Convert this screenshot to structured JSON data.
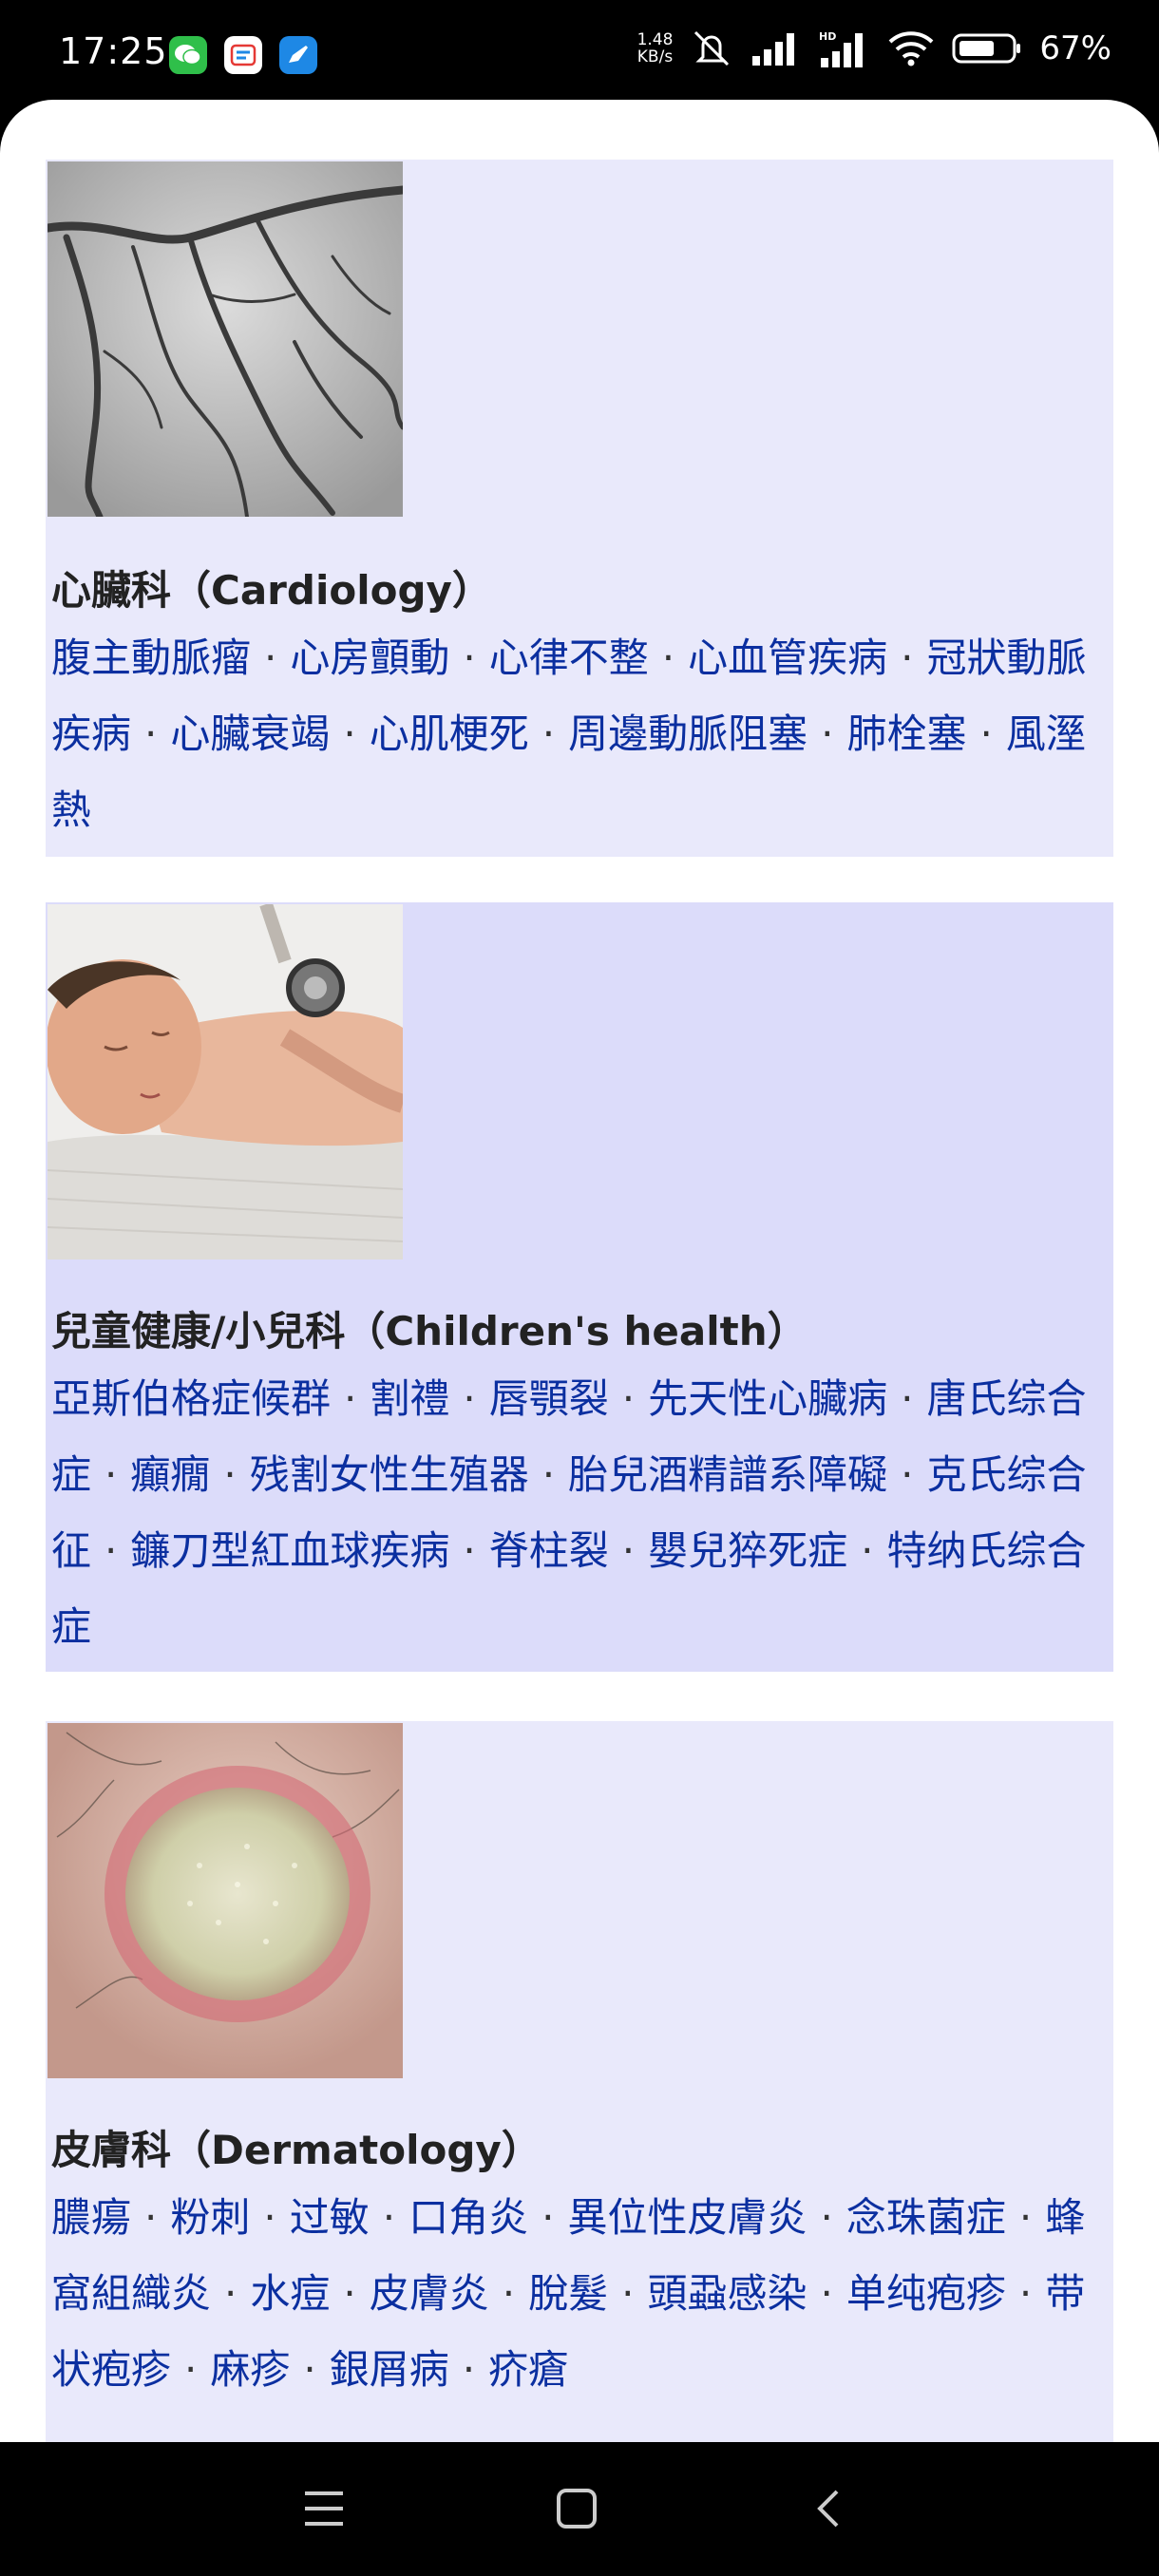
{
  "status_bar": {
    "time": "17:25",
    "speed_value": "1.48",
    "speed_unit": "KB/s",
    "battery_pct": "67%",
    "apps": [
      "wechat-icon",
      "cloud-app-icon",
      "messenger-app-icon"
    ],
    "icons": [
      "mute-icon",
      "signal-icon",
      "hd-signal-icon",
      "wifi-icon",
      "battery-icon"
    ]
  },
  "sections": [
    {
      "title": "心臟科（Cardiology）",
      "image": "coronary-angiogram",
      "bg": "#e9e9fb",
      "links": [
        "腹主動脈瘤",
        "心房顫動",
        "心律不整",
        "心血管疾病",
        "冠狀動脈疾病",
        "心臟衰竭",
        "心肌梗死",
        "周邊動脈阻塞",
        "肺栓塞",
        "風溼熱"
      ]
    },
    {
      "title": "兒童健康/小兒科（Children's health）",
      "image": "newborn-with-stethoscope",
      "bg": "#dcdcfa",
      "links": [
        "亞斯伯格症候群",
        "割禮",
        "唇顎裂",
        "先天性心臟病",
        "唐氏综合症",
        "癲癇",
        "残割女性生殖器",
        "胎兒酒精譜系障礙",
        "克氏综合征",
        "鐮刀型紅血球疾病",
        "脊柱裂",
        "嬰兒猝死症",
        "特纳氏综合症"
      ]
    },
    {
      "title": "皮膚科（Dermatology）",
      "image": "skin-lesion",
      "bg": "#e9e9fb",
      "links": [
        "膿瘍",
        "粉刺",
        "过敏",
        "口角炎",
        "異位性皮膚炎",
        "念珠菌症",
        "蜂窩組織炎",
        "水痘",
        "皮膚炎",
        "脫髮",
        "頭蝨感染",
        "单纯疱疹",
        "带状疱疹",
        "麻疹",
        "銀屑病",
        "疥瘡"
      ]
    }
  ],
  "nav": {
    "menu_icon": "menu-icon",
    "home_icon": "home-icon",
    "back_icon": "back-icon"
  }
}
